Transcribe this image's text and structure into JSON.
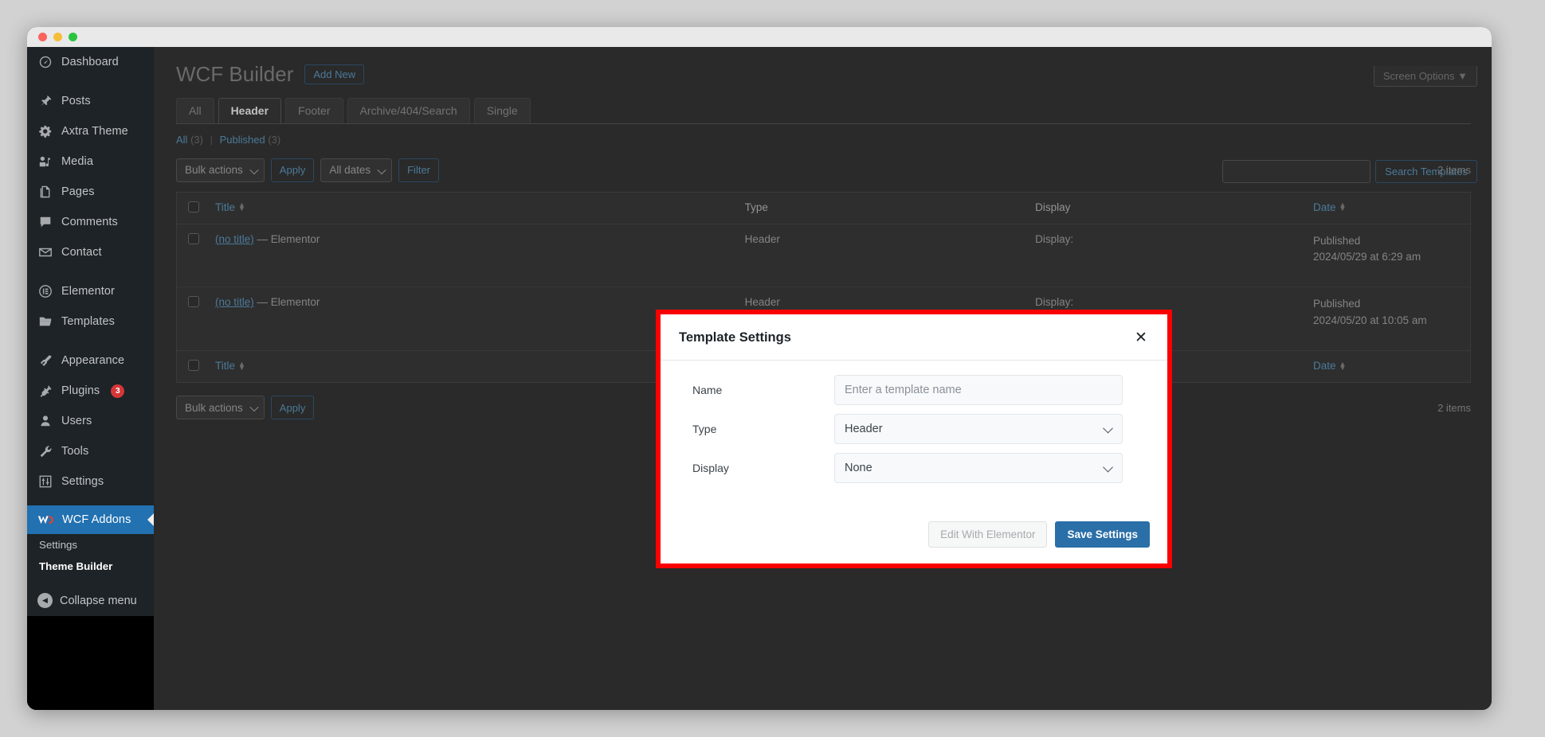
{
  "window": {
    "traffic_lights": [
      "close",
      "minimize",
      "maximize"
    ]
  },
  "sidebar": {
    "items": [
      {
        "label": "Dashboard",
        "icon": "dashboard-icon",
        "gap_after": true
      },
      {
        "label": "Posts",
        "icon": "pin-icon"
      },
      {
        "label": "Axtra Theme",
        "icon": "gear-icon"
      },
      {
        "label": "Media",
        "icon": "media-icon"
      },
      {
        "label": "Pages",
        "icon": "pages-icon"
      },
      {
        "label": "Comments",
        "icon": "comment-icon"
      },
      {
        "label": "Contact",
        "icon": "envelope-icon",
        "gap_after": true
      },
      {
        "label": "Elementor",
        "icon": "elementor-icon"
      },
      {
        "label": "Templates",
        "icon": "folder-icon",
        "gap_after": true
      },
      {
        "label": "Appearance",
        "icon": "brush-icon"
      },
      {
        "label": "Plugins",
        "icon": "plug-icon",
        "badge": "3"
      },
      {
        "label": "Users",
        "icon": "user-icon"
      },
      {
        "label": "Tools",
        "icon": "wrench-icon"
      },
      {
        "label": "Settings",
        "icon": "sliders-icon"
      }
    ],
    "current": {
      "label": "WCF Addons",
      "icon": "wcf-logo-icon"
    },
    "submenu": [
      {
        "label": "Settings",
        "active": false
      },
      {
        "label": "Theme Builder",
        "active": true
      }
    ],
    "collapse": {
      "label": "Collapse menu",
      "icon": "collapse-arrow-icon"
    }
  },
  "header": {
    "screen_options": "Screen Options",
    "screen_options_caret": "▼",
    "page_title": "WCF Builder",
    "add_new": "Add New"
  },
  "tabs": [
    {
      "label": "All",
      "active": false
    },
    {
      "label": "Header",
      "active": true
    },
    {
      "label": "Footer",
      "active": false
    },
    {
      "label": "Archive/404/Search",
      "active": false
    },
    {
      "label": "Single",
      "active": false
    }
  ],
  "status_links": {
    "all_label": "All",
    "all_count": "(3)",
    "separator": "|",
    "published_label": "Published",
    "published_count": "(3)"
  },
  "search": {
    "value": "",
    "placeholder": "",
    "button": "Search Templates"
  },
  "tablenav_top": {
    "bulk_actions": "Bulk actions",
    "apply": "Apply",
    "all_dates": "All dates",
    "filter": "Filter",
    "items_count": "2 items"
  },
  "tablenav_bottom": {
    "bulk_actions": "Bulk actions",
    "apply": "Apply",
    "items_count": "2 items"
  },
  "table": {
    "columns": {
      "title": "Title",
      "type": "Type",
      "display": "Display",
      "date": "Date"
    },
    "rows": [
      {
        "title_link": "(no title)",
        "title_suffix": "— Elementor",
        "type": "Header",
        "display": "Display:",
        "date_status": "Published",
        "date_value": "2024/05/29 at 6:29 am"
      },
      {
        "title_link": "(no title)",
        "title_suffix": "— Elementor",
        "type": "Header",
        "display": "Display:",
        "date_status": "Published",
        "date_value": "2024/05/20 at 10:05 am"
      }
    ]
  },
  "modal": {
    "title": "Template Settings",
    "close_icon": "✕",
    "fields": {
      "name_label": "Name",
      "name_value": "",
      "name_placeholder": "Enter a template name",
      "type_label": "Type",
      "type_value": "Header",
      "display_label": "Display",
      "display_value": "None"
    },
    "buttons": {
      "edit_with_elementor": "Edit With Elementor",
      "save_settings": "Save Settings"
    },
    "highlight_color": "#fa0000"
  },
  "colors": {
    "sidebar_bg": "#1d2327",
    "accent_blue": "#2271b1",
    "badge_red": "#d63638",
    "primary_button": "#2a6fa8",
    "page_bg": "#2c2c2c"
  }
}
